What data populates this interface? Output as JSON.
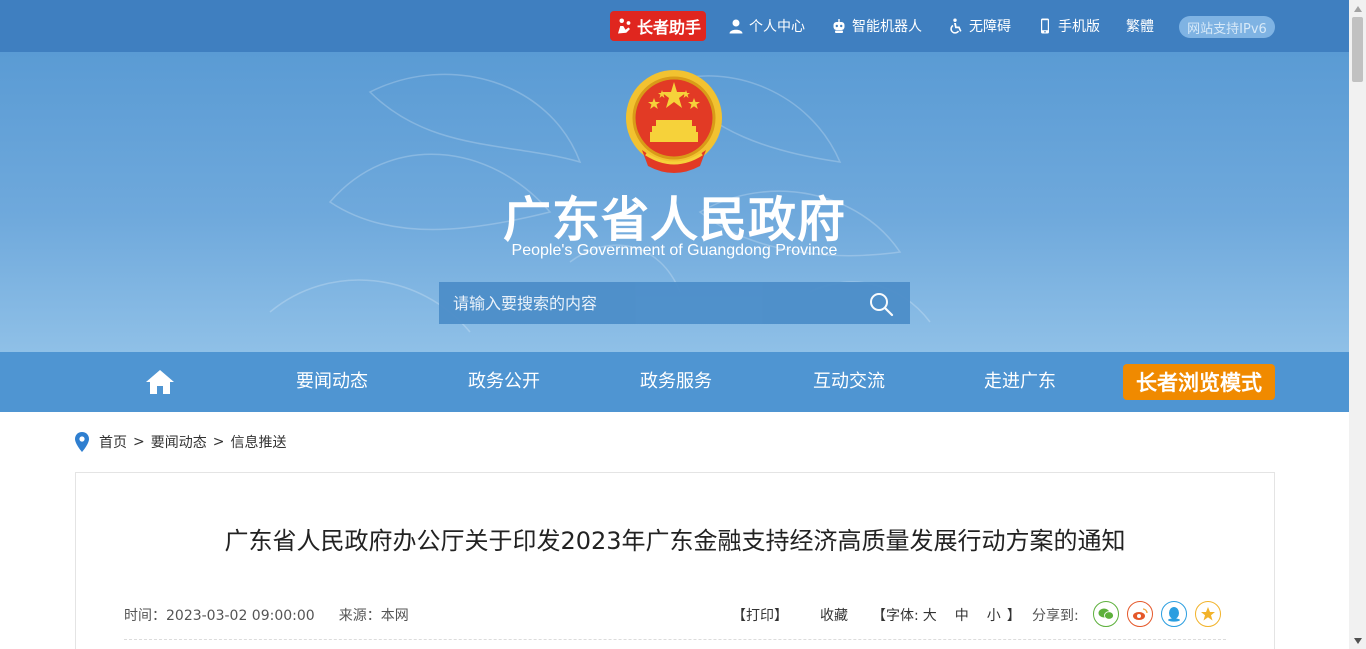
{
  "topbar": {
    "elder_helper": "长者助手",
    "links": [
      {
        "label": "个人中心",
        "icon": "person-icon"
      },
      {
        "label": "智能机器人",
        "icon": "robot-icon"
      },
      {
        "label": "无障碍",
        "icon": "accessibility-icon"
      },
      {
        "label": "手机版",
        "icon": "mobile-icon"
      },
      {
        "label": "繁體",
        "icon": ""
      }
    ],
    "ipv6": "网站支持IPv6"
  },
  "banner": {
    "title": "广东省人民政府",
    "subtitle": "People's Government of Guangdong Province",
    "search_placeholder": "请输入要搜索的内容"
  },
  "nav": {
    "items": [
      "要闻动态",
      "政务公开",
      "政务服务",
      "互动交流",
      "走进广东"
    ],
    "elder_mode": "长者浏览模式"
  },
  "breadcrumb": [
    "首页",
    "要闻动态",
    "信息推送"
  ],
  "article": {
    "title": "广东省人民政府办公厅关于印发2023年广东金融支持经济高质量发展行动方案的通知",
    "time_label": "时间：2023-03-02 09:00:00",
    "source_label": "来源：本网",
    "print": "【打印】",
    "favorite": "收藏",
    "font_prefix": "【字体:",
    "font_large": "大",
    "font_medium": "中",
    "font_small": "小",
    "font_suffix": "】",
    "share_label": "分享到:"
  },
  "colors": {
    "topbar": "#3f7fc0",
    "nav": "#4f95d2",
    "elder_red": "#e0261f",
    "elder_orange": "#f08a00",
    "wechat": "#5db03c",
    "weibo": "#e5582a",
    "qq": "#2a9ee0",
    "qzone": "#f2b32a"
  }
}
